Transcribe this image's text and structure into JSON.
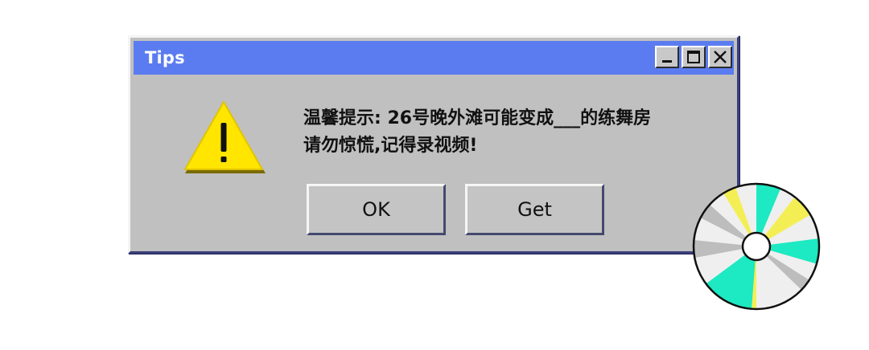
{
  "window": {
    "title": "Tips",
    "minimize_icon": "minimize-icon",
    "maximize_icon": "maximize-icon",
    "close_icon": "close-icon"
  },
  "message": {
    "line1": "温馨提示: 26号晚外滩可能变成___的练舞房",
    "line2": "请勿惊慌,记得录视频!"
  },
  "buttons": {
    "ok_label": "OK",
    "get_label": "Get"
  },
  "icons": {
    "warning": "warning-triangle-icon",
    "disc": "compact-disc-icon"
  },
  "colors": {
    "titlebar": "#5b7cf0",
    "dialog_bg": "#c0c0c0",
    "warning_yellow": "#ffe500",
    "disc_accent_teal": "#1de9c2",
    "disc_accent_yellow": "#f4ee55"
  }
}
